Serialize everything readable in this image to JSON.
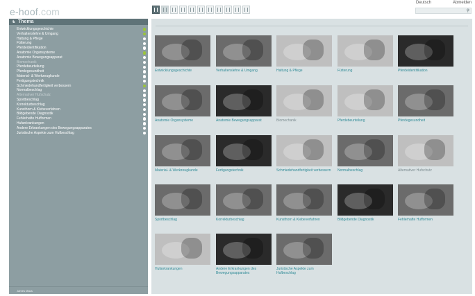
{
  "header": {
    "logo_main": "e-hoof",
    "logo_dot": ".com",
    "lang": "Deutsch",
    "logout": "Abmelden"
  },
  "toolbar": {
    "icons": [
      "horse-icon",
      "edit-icon",
      "list-icon",
      "page-icon",
      "page-icon",
      "pencil-icon",
      "question-icon",
      "bar-icon",
      "grid-icon",
      "info-icon",
      "image-icon"
    ]
  },
  "search": {
    "placeholder": ""
  },
  "sidebar": {
    "title": "Thema",
    "items": [
      {
        "label": "Entwicklungsgeschichte",
        "dim": false,
        "dot": "green"
      },
      {
        "label": "Verhaltenslehre & Umgang",
        "dim": false,
        "dot": "green"
      },
      {
        "label": "Haltung & Pflege",
        "dim": false,
        "dot": "white"
      },
      {
        "label": "Fütterung",
        "dim": false,
        "dot": "white"
      },
      {
        "label": "Pferdeidentifikation",
        "dim": false,
        "dot": "white"
      },
      {
        "label": "Anatomie Organsysteme",
        "dim": false,
        "dot": "green"
      },
      {
        "label": "Anatomie Bewegungsapparat",
        "dim": false,
        "dot": "white"
      },
      {
        "label": "Biomechanik",
        "dim": true,
        "dot": "white"
      },
      {
        "label": "Pferdebeurteilung",
        "dim": false,
        "dot": "white"
      },
      {
        "label": "Pferdegesundheit",
        "dim": false,
        "dot": "white"
      },
      {
        "label": "Material- & Werkzeugkunde",
        "dim": false,
        "dot": "white"
      },
      {
        "label": "Fertigungstechnik",
        "dim": false,
        "dot": "white"
      },
      {
        "label": "Schmiedehandfertigkeit verbessern",
        "dim": false,
        "dot": "green"
      },
      {
        "label": "Normalbeschlag",
        "dim": false,
        "dot": "white"
      },
      {
        "label": "Alternativer Hufschutz",
        "dim": true,
        "dot": "white"
      },
      {
        "label": "Sportbeschlag",
        "dim": false,
        "dot": "white"
      },
      {
        "label": "Korrekturbeschlag",
        "dim": false,
        "dot": "white"
      },
      {
        "label": "Kunsthorn & Klebeverfahren",
        "dim": false,
        "dot": "white"
      },
      {
        "label": "Bildgebende Diagnostik",
        "dim": false,
        "dot": "white"
      },
      {
        "label": "Fehlerhafte Hufformen",
        "dim": false,
        "dot": "white"
      },
      {
        "label": "Hufankrankungen",
        "dim": false,
        "dot": "white"
      },
      {
        "label": "Andere Erkrankungen des Bewegungsapparates",
        "dim": false,
        "dot": "white"
      },
      {
        "label": "Juristische Aspekte zum Hufbeschlag",
        "dim": false,
        "dot": "white"
      }
    ],
    "footer": "Jahres Maus"
  },
  "tiles": [
    {
      "label": "Entwicklungsgeschichte",
      "dim": false,
      "tone": "mid"
    },
    {
      "label": "Verhaltenslehre & Umgang",
      "dim": false,
      "tone": "mid"
    },
    {
      "label": "Haltung & Pflege",
      "dim": false,
      "tone": "light"
    },
    {
      "label": "Fütterung",
      "dim": false,
      "tone": "light"
    },
    {
      "label": "Pferdeidentifikation",
      "dim": false,
      "tone": "dark"
    },
    {
      "label": "Anatomie Organsysteme",
      "dim": false,
      "tone": "mid"
    },
    {
      "label": "Anatomie Bewegungsapparat",
      "dim": false,
      "tone": "dark"
    },
    {
      "label": "Biomechanik",
      "dim": true,
      "tone": "light"
    },
    {
      "label": "Pferdebeurteilung",
      "dim": false,
      "tone": "light"
    },
    {
      "label": "Pferdegesundheit",
      "dim": false,
      "tone": "mid"
    },
    {
      "label": "Material- & Werkzeugkunde",
      "dim": false,
      "tone": "mid"
    },
    {
      "label": "Fertigungstechnik",
      "dim": false,
      "tone": "dark"
    },
    {
      "label": "Schmiedehandfertigkeit verbessern",
      "dim": false,
      "tone": "light"
    },
    {
      "label": "Normalbeschlag",
      "dim": false,
      "tone": "mid"
    },
    {
      "label": "Alternativer Hufschutz",
      "dim": true,
      "tone": "light"
    },
    {
      "label": "Sportbeschlag",
      "dim": false,
      "tone": "mid"
    },
    {
      "label": "Korrekturbeschlag",
      "dim": false,
      "tone": "mid"
    },
    {
      "label": "Kunsthorn & Klebeverfahren",
      "dim": false,
      "tone": "mid"
    },
    {
      "label": "Bildgebende Diagnostik",
      "dim": false,
      "tone": "dark"
    },
    {
      "label": "Fehlerhafte Hufformen",
      "dim": false,
      "tone": "mid"
    },
    {
      "label": "Hufankrankungen",
      "dim": false,
      "tone": "light"
    },
    {
      "label": "Andere Erkrankungen des Bewegungsapparates",
      "dim": false,
      "tone": "dark"
    },
    {
      "label": "Juristische Aspekte zum Hufbeschlag",
      "dim": false,
      "tone": "mid"
    }
  ],
  "colors": {
    "accent": "#2e8a96",
    "sidebar_bg": "#8d9ea2",
    "main_bg": "#d9e1e3",
    "green_dot": "#9bc43c"
  }
}
